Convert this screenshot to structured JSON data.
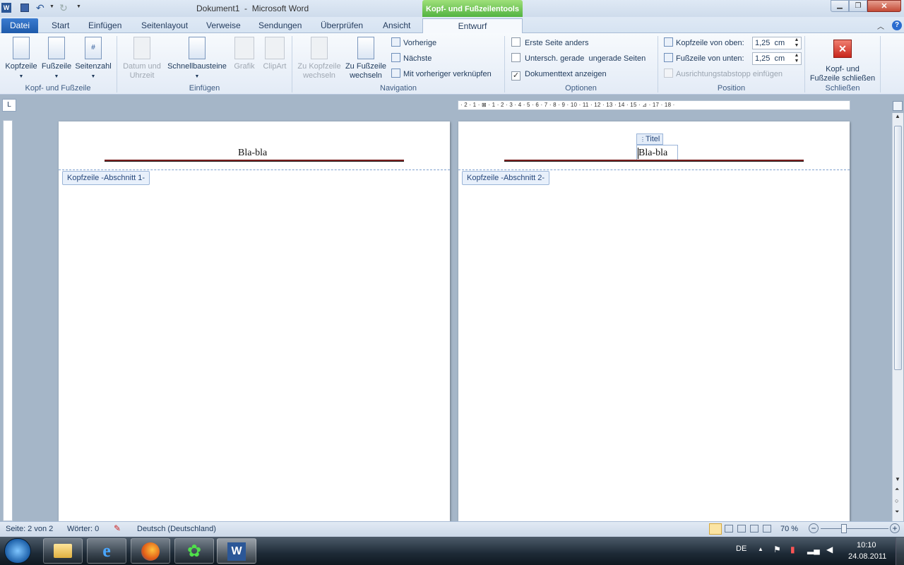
{
  "window": {
    "title": "Dokument1  -  Microsoft Word",
    "context_header": "Kopf- und Fußzeilentools"
  },
  "tabs": [
    "Datei",
    "Start",
    "Einfügen",
    "Seitenlayout",
    "Verweise",
    "Sendungen",
    "Überprüfen",
    "Ansicht",
    "Entwurf"
  ],
  "ribbon": {
    "group1": {
      "label": "Kopf- und Fußzeile",
      "buttons": [
        "Kopfzeile",
        "Fußzeile",
        "Seitenzahl"
      ]
    },
    "group2": {
      "label": "Einfügen",
      "datum_l1": "Datum und",
      "datum_l2": "Uhrzeit",
      "schnell": "Schnellbausteine",
      "grafik": "Grafik",
      "clipart": "ClipArt"
    },
    "group3": {
      "label": "Navigation",
      "zukopf_l1": "Zu Kopfzeile",
      "zukopf_l2": "wechseln",
      "zufuss_l1": "Zu Fußzeile",
      "zufuss_l2": "wechseln",
      "vorherige": "Vorherige",
      "naechste": "Nächste",
      "verknuepfen": "Mit vorheriger verknüpfen"
    },
    "group4": {
      "label": "Optionen",
      "opt1": "Erste Seite anders",
      "opt2": "Untersch. gerade  ungerade Seiten",
      "opt3": "Dokumenttext anzeigen",
      "opt3_check": "✓"
    },
    "group5": {
      "label": "Position",
      "kopf_label": "Kopfzeile von oben:",
      "kopf_value": "1,25  cm",
      "fuss_label": "Fußzeile von unten:",
      "fuss_value": "1,25  cm",
      "ausricht": "Ausrichtungstabstopp einfügen"
    },
    "group6": {
      "label": "Schließen",
      "close_l1": "Kopf- und",
      "close_l2": "Fußzeile schließen"
    }
  },
  "ruler_text": "· 2 · 1 · ⊠ · 1 · 2 · 3 · 4 · 5 · 6 · 7 · 8 · 9 · 10 · 11 · 12 · 13 · 14 · 15 · ⊿ · 17 · 18 ·",
  "pages": {
    "p1": {
      "header_text": "Bla-bla",
      "section_label": "Kopfzeile -Abschnitt 1-"
    },
    "p2": {
      "header_text": "Bla-bla",
      "section_label": "Kopfzeile -Abschnitt 2-",
      "tag": "Titel"
    }
  },
  "status": {
    "page": "Seite: 2 von 2",
    "words": "Wörter: 0",
    "language": "Deutsch (Deutschland)",
    "zoom": "70 %"
  },
  "tray": {
    "lang": "DE",
    "time": "10:10",
    "date": "24.08.2011"
  },
  "colors": {
    "context_green": "#4caf3c",
    "file_tab_blue": "#1f5bab",
    "close_red": "#d12a2a"
  }
}
